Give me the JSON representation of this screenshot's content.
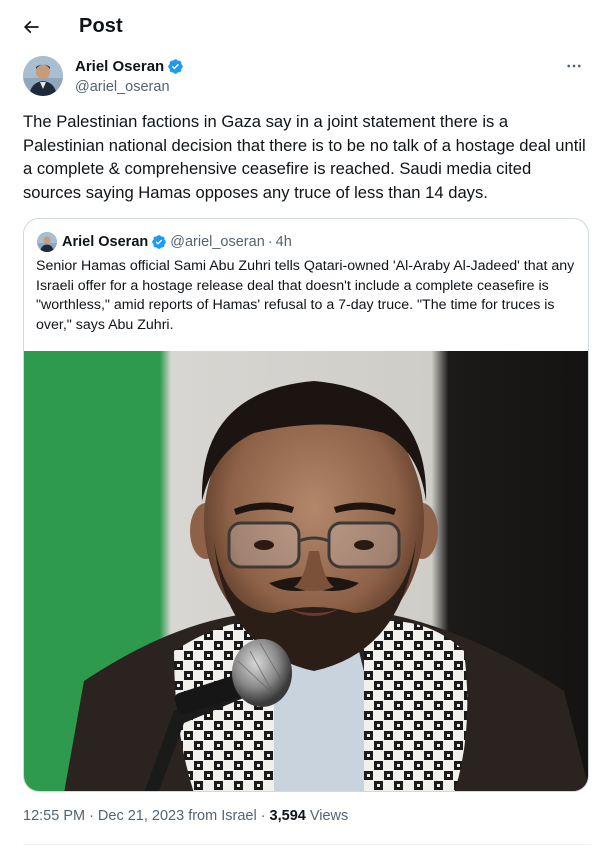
{
  "header": {
    "title": "Post"
  },
  "author": {
    "name": "Ariel Oseran",
    "handle": "@ariel_oseran"
  },
  "tweet": {
    "text": "The Palestinian factions in Gaza say in a joint statement there is a Palestinian national decision that there is to be no talk of a hostage deal until a complete & comprehensive ceasefire is reached. Saudi media cited sources saying Hamas opposes any truce of less than 14 days."
  },
  "quote": {
    "name": "Ariel Oseran",
    "handle": "@ariel_oseran",
    "separator": "·",
    "time": "4h",
    "text": "Senior Hamas official Sami Abu Zuhri tells Qatari-owned 'Al-Araby Al-Jadeed' that any Israeli offer for a hostage release deal that doesn't include a complete ceasefire is \"worthless,\" amid reports of Hamas' refusal to a 7-day truce. \"The time for truces is over,\" says Abu Zuhri."
  },
  "meta": {
    "time": "12:55 PM",
    "dot1": "·",
    "date": "Dec 21, 2023",
    "source": "from Israel",
    "dot2": "·",
    "views_count": "3,594",
    "views_label": "Views"
  },
  "icons": {
    "back": "arrow-left-icon",
    "more": "more-horizontal-icon",
    "verified": "verified-badge-icon"
  },
  "colors": {
    "verified_blue": "#1d9bf0",
    "secondary_text": "#536471",
    "primary_text": "#0f1419",
    "border": "#cfd9de"
  }
}
